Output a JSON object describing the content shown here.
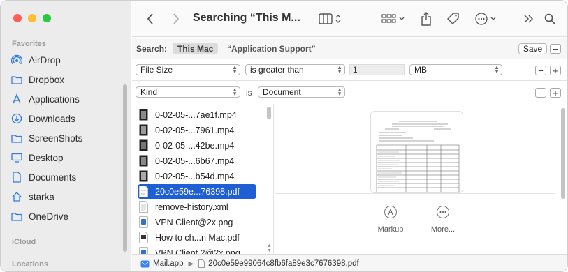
{
  "window": {
    "title": "Searching “This M..."
  },
  "colors": {
    "close": "#fe5f57",
    "minimize": "#febc2e",
    "zoom": "#28c840",
    "accent": "#1f5fd6",
    "folder_icon": "#2f7be0"
  },
  "sidebar": {
    "favorites_header": "Favorites",
    "items": [
      {
        "label": "AirDrop",
        "icon": "airdrop-icon"
      },
      {
        "label": "Dropbox",
        "icon": "folder-icon"
      },
      {
        "label": "Applications",
        "icon": "applications-icon"
      },
      {
        "label": "Downloads",
        "icon": "downloads-icon"
      },
      {
        "label": "ScreenShots",
        "icon": "folder-icon"
      },
      {
        "label": "Desktop",
        "icon": "desktop-icon"
      },
      {
        "label": "Documents",
        "icon": "document-icon"
      },
      {
        "label": "starka",
        "icon": "home-icon"
      },
      {
        "label": "OneDrive",
        "icon": "folder-icon"
      }
    ],
    "icloud_header": "iCloud",
    "locations_header": "Locations"
  },
  "toolbar": {
    "back_icon": "chevron-left-icon",
    "forward_icon": "chevron-right-icon",
    "view_icon": "columns-view-icon",
    "group_icon": "grid-icon",
    "share_icon": "share-icon",
    "tag_icon": "tag-icon",
    "more_icon": "ellipsis-icon",
    "extend_icon": "double-chevron-icon",
    "search_icon": "search-icon"
  },
  "search": {
    "label": "Search:",
    "scope_selected": "This Mac",
    "scope_other": "“Application Support”",
    "save_label": "Save",
    "criteria": [
      {
        "attribute": "File Size",
        "operator": "is greater than",
        "value": "1",
        "unit": "MB"
      },
      {
        "attribute": "Kind",
        "operator": "is",
        "value": "Document"
      }
    ]
  },
  "files": [
    {
      "name": "0-02-05-...7ae1f.mp4",
      "type": "video"
    },
    {
      "name": "0-02-05-...7961.mp4",
      "type": "video"
    },
    {
      "name": "0-02-05-...42be.mp4",
      "type": "video"
    },
    {
      "name": "0-02-05-...6b67.mp4",
      "type": "video"
    },
    {
      "name": "0-02-05-...b54d.mp4",
      "type": "video"
    },
    {
      "name": "20c0e59e...76398.pdf",
      "type": "pdf",
      "selected": true
    },
    {
      "name": "remove-history.xml",
      "type": "xml"
    },
    {
      "name": "VPN Client@2x.png",
      "type": "png"
    },
    {
      "name": "How to ch...n Mac.pdf",
      "type": "pdf"
    },
    {
      "name": "VPN Client 2@2x.png",
      "type": "png"
    }
  ],
  "preview": {
    "actions": [
      {
        "label": "Markup",
        "icon": "markup-icon"
      },
      {
        "label": "More...",
        "icon": "more-icon"
      }
    ]
  },
  "pathbar": {
    "app": "Mail.app",
    "file": "20c0e59e99064c8fb6fa89e3c7676398.pdf"
  }
}
